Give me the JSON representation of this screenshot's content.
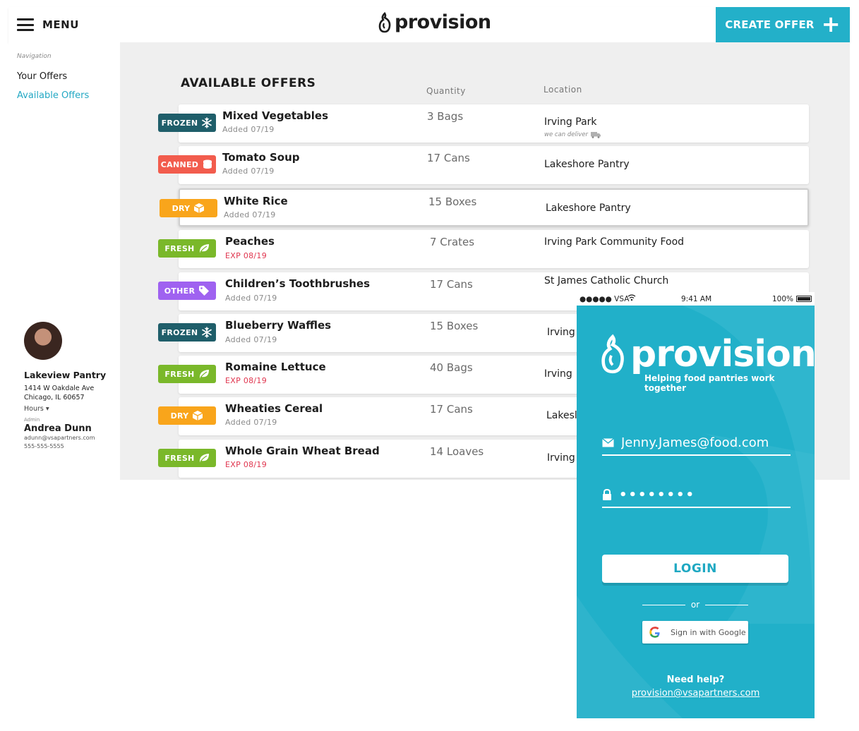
{
  "header": {
    "menu_label": "MENU",
    "brand": "provision",
    "create_offer_label": "CREATE OFFER"
  },
  "sidebar": {
    "nav_heading": "Navigation",
    "items": [
      {
        "label": "Your Offers"
      },
      {
        "label": "Available Offers"
      }
    ]
  },
  "profile": {
    "pantry_name": "Lakeview Pantry",
    "address_line1": "1414 W Oakdale Ave",
    "address_line2": "Chicago, IL 60657",
    "hours_label": "Hours",
    "admin_label": "Admin",
    "admin_name": "Andrea Dunn",
    "admin_email": "adunn@vsapartners.com",
    "admin_phone": "555-555-5555"
  },
  "offers": {
    "title": "AVAILABLE OFFERS",
    "col_quantity": "Quantity",
    "col_location": "Location",
    "rows": [
      {
        "category": "FROZEN",
        "name": "Mixed Vegetables",
        "sub": "Added 07/19",
        "qty": "3 Bags",
        "location": "Irving Park",
        "note": "we can deliver"
      },
      {
        "category": "CANNED",
        "name": "Tomato Soup",
        "sub": "Added 07/19",
        "qty": "17 Cans",
        "location": "Lakeshore Pantry"
      },
      {
        "category": "DRY",
        "name": "White Rice",
        "sub": "Added 07/19",
        "qty": "15 Boxes",
        "location": "Lakeshore Pantry"
      },
      {
        "category": "FRESH",
        "name": "Peaches",
        "sub": "EXP 08/19",
        "qty": "7 Crates",
        "location": "Irving Park Community Food"
      },
      {
        "category": "OTHER",
        "name": "Children’s Toothbrushes",
        "sub": "Added 07/19",
        "qty": "17 Cans",
        "location": "St James Catholic Church"
      },
      {
        "category": "FROZEN",
        "name": "Blueberry Waffles",
        "sub": "Added 07/19",
        "qty": "15 Boxes",
        "location": "Irving"
      },
      {
        "category": "FRESH",
        "name": "Romaine Lettuce",
        "sub": "EXP 08/19",
        "qty": "40 Bags",
        "location": "Irving"
      },
      {
        "category": "DRY",
        "name": "Wheaties Cereal",
        "sub": "Added 07/19",
        "qty": "17 Cans",
        "location": "Lakesl"
      },
      {
        "category": "FRESH",
        "name": "Whole Grain Wheat Bread",
        "sub": "EXP 08/19",
        "qty": "14 Loaves",
        "location": "Irving"
      }
    ]
  },
  "category_colors": {
    "FROZEN": "#1f5e6a",
    "CANNED": "#f25c4d",
    "DRY": "#f9a51b",
    "FRESH": "#7ab82a",
    "OTHER": "#9f62f0"
  },
  "accent_color": "#23b0c9",
  "mobile": {
    "status": {
      "carrier": "●●●●● VSA",
      "time": "9:41 AM",
      "battery": "100%"
    },
    "brand": "provision",
    "tagline": "Helping food pantries work together",
    "email_value": "Jenny.James@food.com",
    "password_value": "••••••••",
    "login_label": "LOGIN",
    "or_label": "or",
    "google_label": "Sign in with Google",
    "help_title": "Need help?",
    "help_email": "provision@vsapartners.com"
  }
}
